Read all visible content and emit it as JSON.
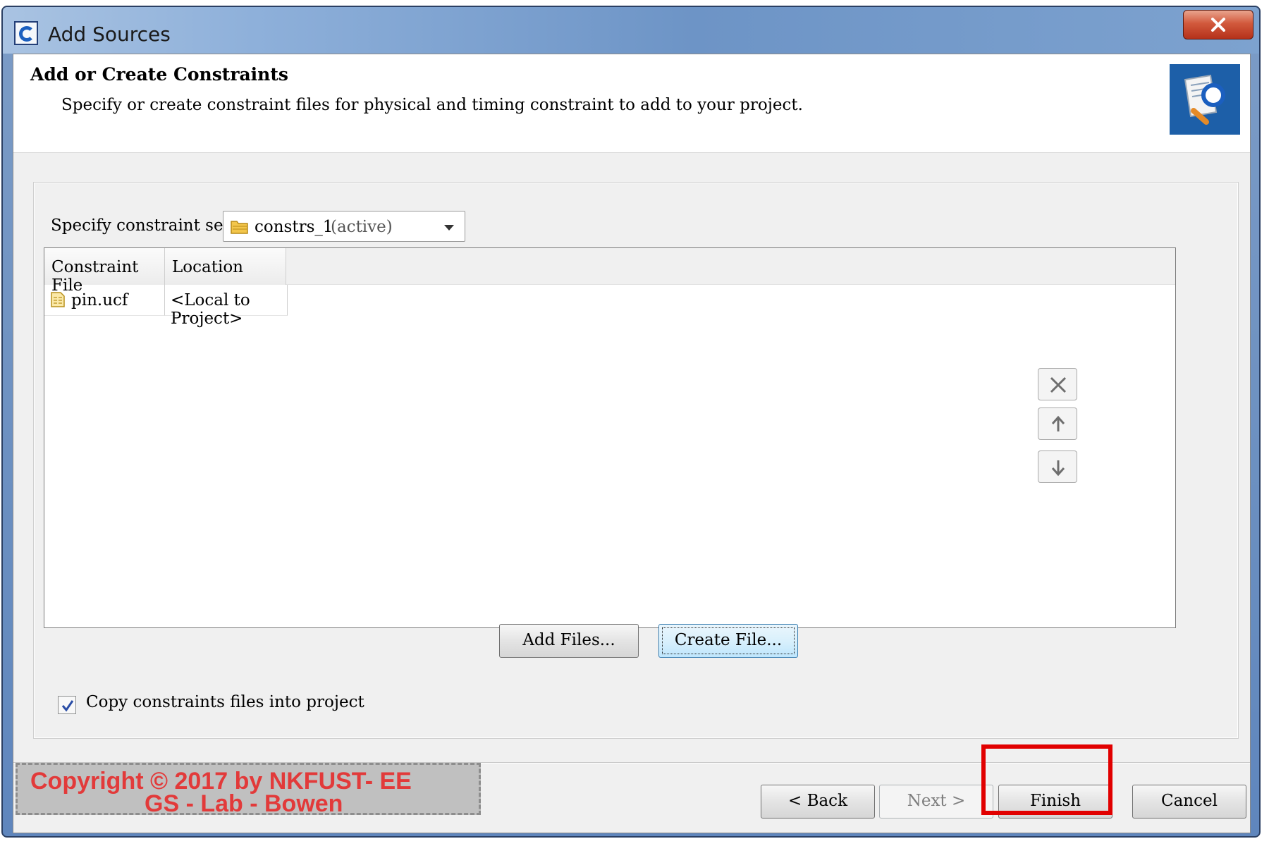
{
  "window": {
    "title": "Add Sources"
  },
  "header": {
    "title": "Add or Create Constraints",
    "subtitle": "Specify or create constraint files for physical and timing constraint to add to your project."
  },
  "constraint_set": {
    "label": "Specify constraint set:",
    "value": "constrs_1",
    "state": "(active)"
  },
  "table": {
    "columns": [
      "Constraint File",
      "Location"
    ],
    "rows": [
      {
        "file": "pin.ucf",
        "location": "<Local to Project>"
      }
    ]
  },
  "side_buttons": [
    "remove-icon",
    "move-up-icon",
    "move-down-icon"
  ],
  "actions": {
    "add_files": "Add Files...",
    "create_file": "Create File..."
  },
  "copy_option": {
    "label": "Copy constraints files into project",
    "checked": true
  },
  "footer": {
    "back": "< Back",
    "next": "Next >",
    "finish": "Finish",
    "cancel": "Cancel"
  },
  "watermark": {
    "line1": "Copyright © 2017 by NKFUST- EE",
    "line2": "GS - Lab - Bowen"
  },
  "colors": {
    "highlight": "#e10000",
    "watermark_text": "#e23a3a"
  }
}
